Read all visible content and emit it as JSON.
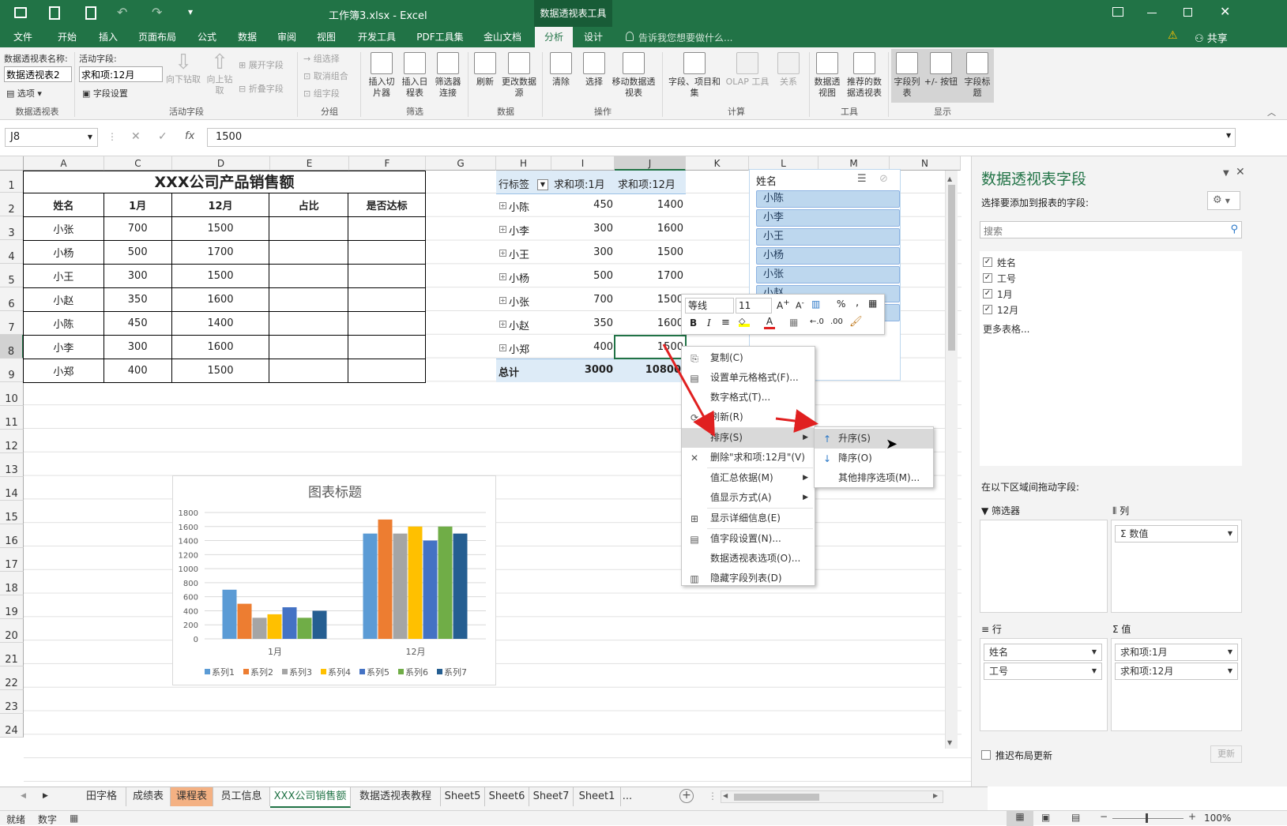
{
  "titlebar": {
    "title": "工作簿3.xlsx  -  Excel",
    "context_tab": "数据透视表工具",
    "qat_more": "▾"
  },
  "tabs": [
    "文件",
    "开始",
    "插入",
    "页面布局",
    "公式",
    "数据",
    "审阅",
    "视图",
    "开发工具",
    "PDF工具集",
    "金山文档",
    "分析",
    "设计"
  ],
  "tellme": "告诉我您想要做什么...",
  "share": "共享",
  "ribbon": {
    "pt_name_label": "数据透视表名称:",
    "pt_name": "数据透视表2",
    "options": "选项",
    "active_field_label": "活动字段:",
    "active_field": "求和项:12月",
    "field_settings": "字段设置",
    "drill_down": "向下钻取",
    "drill_up": "向上钻取",
    "expand": "展开字段",
    "collapse": "折叠字段",
    "group_select": "组选择",
    "ungroup": "取消组合",
    "group_field": "组字段",
    "insert_slicer": "插入切片器",
    "insert_timeline": "插入日程表",
    "filter_conn": "筛选器连接",
    "refresh": "刷新",
    "change_source": "更改数据源",
    "clear": "清除",
    "select": "选择",
    "move_pt": "移动数据透视表",
    "fields_items": "字段、项目和集",
    "olap": "OLAP 工具",
    "relations": "关系",
    "pivotchart": "数据透视图",
    "recommended": "推荐的数据透视表",
    "field_list": "字段列表",
    "plus_minus": "+/- 按钮",
    "field_headers": "字段标题",
    "groups": [
      "数据透视表",
      "活动字段",
      "分组",
      "筛选",
      "数据",
      "操作",
      "计算",
      "工具",
      "显示"
    ]
  },
  "formula": {
    "namebox": "J8",
    "value": "1500",
    "fx": "fx"
  },
  "columns": [
    "A",
    "C",
    "D",
    "E",
    "F",
    "G",
    "H",
    "I",
    "J",
    "K",
    "L",
    "M",
    "N"
  ],
  "rows": [
    "1",
    "2",
    "3",
    "4",
    "5",
    "6",
    "7",
    "8",
    "9",
    "10",
    "11",
    "12",
    "13",
    "14",
    "15",
    "16",
    "17",
    "18",
    "19",
    "20",
    "21",
    "22",
    "23",
    "24"
  ],
  "table": {
    "title": "XXX公司产品销售额",
    "headers": [
      "姓名",
      "1月",
      "12月",
      "占比",
      "是否达标"
    ],
    "data": [
      [
        "小张",
        "700",
        "1500"
      ],
      [
        "小杨",
        "500",
        "1700"
      ],
      [
        "小王",
        "300",
        "1500"
      ],
      [
        "小赵",
        "350",
        "1600"
      ],
      [
        "小陈",
        "450",
        "1400"
      ],
      [
        "小李",
        "300",
        "1600"
      ],
      [
        "小郑",
        "400",
        "1500"
      ]
    ]
  },
  "pivot": {
    "headers": [
      "行标签",
      "求和项:1月",
      "求和项:12月"
    ],
    "rows": [
      [
        "小陈",
        "450",
        "1400"
      ],
      [
        "小李",
        "300",
        "1600"
      ],
      [
        "小王",
        "300",
        "1500"
      ],
      [
        "小杨",
        "500",
        "1700"
      ],
      [
        "小张",
        "700",
        "1500"
      ],
      [
        "小赵",
        "350",
        "1600"
      ],
      [
        "小郑",
        "400",
        "1500"
      ]
    ],
    "total": [
      "总计",
      "3000",
      "10800"
    ]
  },
  "slicer": {
    "title": "姓名",
    "items": [
      "小陈",
      "小李",
      "小王",
      "小杨",
      "小张",
      "小赵",
      "小郑"
    ]
  },
  "chart_data": {
    "type": "bar",
    "title": "图表标题",
    "categories": [
      "1月",
      "12月"
    ],
    "ylim": [
      0,
      1800
    ],
    "yticks": [
      0,
      200,
      400,
      600,
      800,
      1000,
      1200,
      1400,
      1600,
      1800
    ],
    "series": [
      {
        "name": "系列1",
        "values": [
          700,
          1500
        ],
        "color": "#5b9bd5"
      },
      {
        "name": "系列2",
        "values": [
          500,
          1700
        ],
        "color": "#ed7d31"
      },
      {
        "name": "系列3",
        "values": [
          300,
          1500
        ],
        "color": "#a5a5a5"
      },
      {
        "name": "系列4",
        "values": [
          350,
          1600
        ],
        "color": "#ffc000"
      },
      {
        "name": "系列5",
        "values": [
          450,
          1400
        ],
        "color": "#4472c4"
      },
      {
        "name": "系列6",
        "values": [
          300,
          1600
        ],
        "color": "#70ad47"
      },
      {
        "name": "系列7",
        "values": [
          400,
          1500
        ],
        "color": "#255e91"
      }
    ],
    "grid": true,
    "legend": "bottom"
  },
  "minitoolbar": {
    "font": "等线",
    "size": "11"
  },
  "context_menu": [
    "复制(C)",
    "设置单元格格式(F)...",
    "数字格式(T)...",
    "刷新(R)",
    "排序(S)",
    "删除\"求和项:12月\"(V)",
    "值汇总依据(M)",
    "值显示方式(A)",
    "显示详细信息(E)",
    "值字段设置(N)...",
    "数据透视表选项(O)...",
    "隐藏字段列表(D)"
  ],
  "submenu": [
    "升序(S)",
    "降序(O)",
    "其他排序选项(M)..."
  ],
  "pane": {
    "title": "数据透视表字段",
    "subtitle": "选择要添加到报表的字段:",
    "search_placeholder": "搜索",
    "fields": [
      "姓名",
      "工号",
      "1月",
      "12月"
    ],
    "more": "更多表格...",
    "drag_label": "在以下区域间拖动字段:",
    "filters": "筛选器",
    "columns": "列",
    "rows": "行",
    "values": "值",
    "col_items": [
      "数值"
    ],
    "row_items": [
      "姓名",
      "工号"
    ],
    "val_items": [
      "求和项:1月",
      "求和项:12月"
    ],
    "defer": "推迟布局更新",
    "update": "更新"
  },
  "sheets": [
    "田字格",
    "成绩表",
    "课程表",
    "员工信息",
    "XXX公司销售额",
    "数据透视表教程",
    "Sheet5",
    "Sheet6",
    "Sheet7",
    "Sheet1",
    "..."
  ],
  "status": {
    "ready": "就绪",
    "num": "数字",
    "zoom": "100%"
  },
  "colors": {
    "excel_green": "#217346",
    "pivot_header": "#ddebf7",
    "slicer_item": "#bdd7ee",
    "arrow": "#e02020"
  }
}
